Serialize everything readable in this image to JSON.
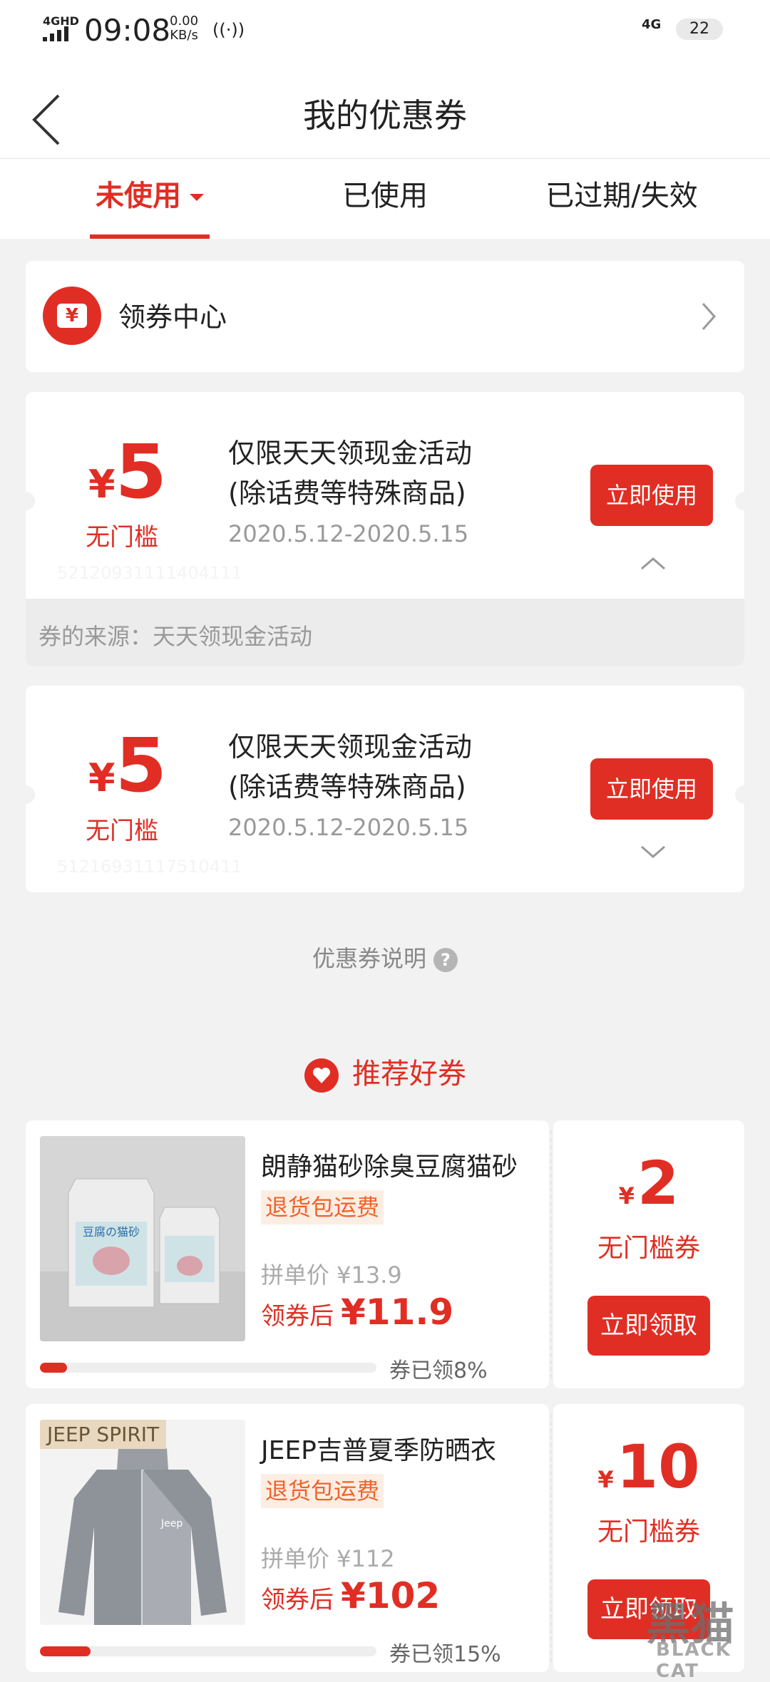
{
  "status_bar": {
    "network": "4GHD",
    "time": "09:08",
    "speed_value": "0.00",
    "speed_unit": "KB/s",
    "hotspot_icon": "((·))",
    "network_right": "4G",
    "battery": "22"
  },
  "header": {
    "title": "我的优惠券"
  },
  "tabs": [
    {
      "label": "未使用",
      "active": true
    },
    {
      "label": "已使用",
      "active": false
    },
    {
      "label": "已过期/失效",
      "active": false
    }
  ],
  "coupon_center": {
    "icon_glyph": "¥",
    "label": "领券中心"
  },
  "coupons": [
    {
      "currency": "¥",
      "amount": "5",
      "condition": "无门槛",
      "title_line1": "仅限天天领现金活动",
      "title_line2": "(除话费等特殊商品)",
      "date_range": "2020.5.12-2020.5.15",
      "button": "立即使用",
      "code": "52120931111404111",
      "expanded": true,
      "source": "券的来源：天天领现金活动"
    },
    {
      "currency": "¥",
      "amount": "5",
      "condition": "无门槛",
      "title_line1": "仅限天天领现金活动",
      "title_line2": "(除话费等特殊商品)",
      "date_range": "2020.5.12-2020.5.15",
      "button": "立即使用",
      "code": "51216931117510411",
      "expanded": false
    }
  ],
  "explanation": {
    "label": "优惠券说明",
    "help_glyph": "?"
  },
  "recommend": {
    "title": "推荐好券"
  },
  "products": [
    {
      "name": "朗静猫砂除臭豆腐猫砂",
      "tag": "退货包运费",
      "group_price": "拼单价 ¥13.9",
      "after_label": "领券后",
      "after_price": "¥11.9",
      "claimed_text": "券已领8%",
      "claimed_fraction": 0.08,
      "coupon_currency": "¥",
      "coupon_amount": "2",
      "coupon_label": "无门槛券",
      "button": "立即领取",
      "image_text": "豆腐の猫砂"
    },
    {
      "name": "JEEP吉普夏季防晒衣",
      "brand_tag": "JEEP SPIRIT",
      "tag": "退货包运费",
      "group_price": "拼单价 ¥112",
      "after_label": "领券后",
      "after_price": "¥102",
      "claimed_text": "券已领15%",
      "claimed_fraction": 0.15,
      "coupon_currency": "¥",
      "coupon_amount": "10",
      "coupon_label": "无门槛券",
      "button": "立即领取",
      "image_text": "Jeep"
    }
  ],
  "watermark": {
    "hanzi": "黑猫",
    "text": "BLACK CAT"
  },
  "colors": {
    "accent": "#e02e24",
    "tag_bg": "#fdeee4",
    "tag_fg": "#f0632a",
    "background": "#f2f2f2"
  }
}
